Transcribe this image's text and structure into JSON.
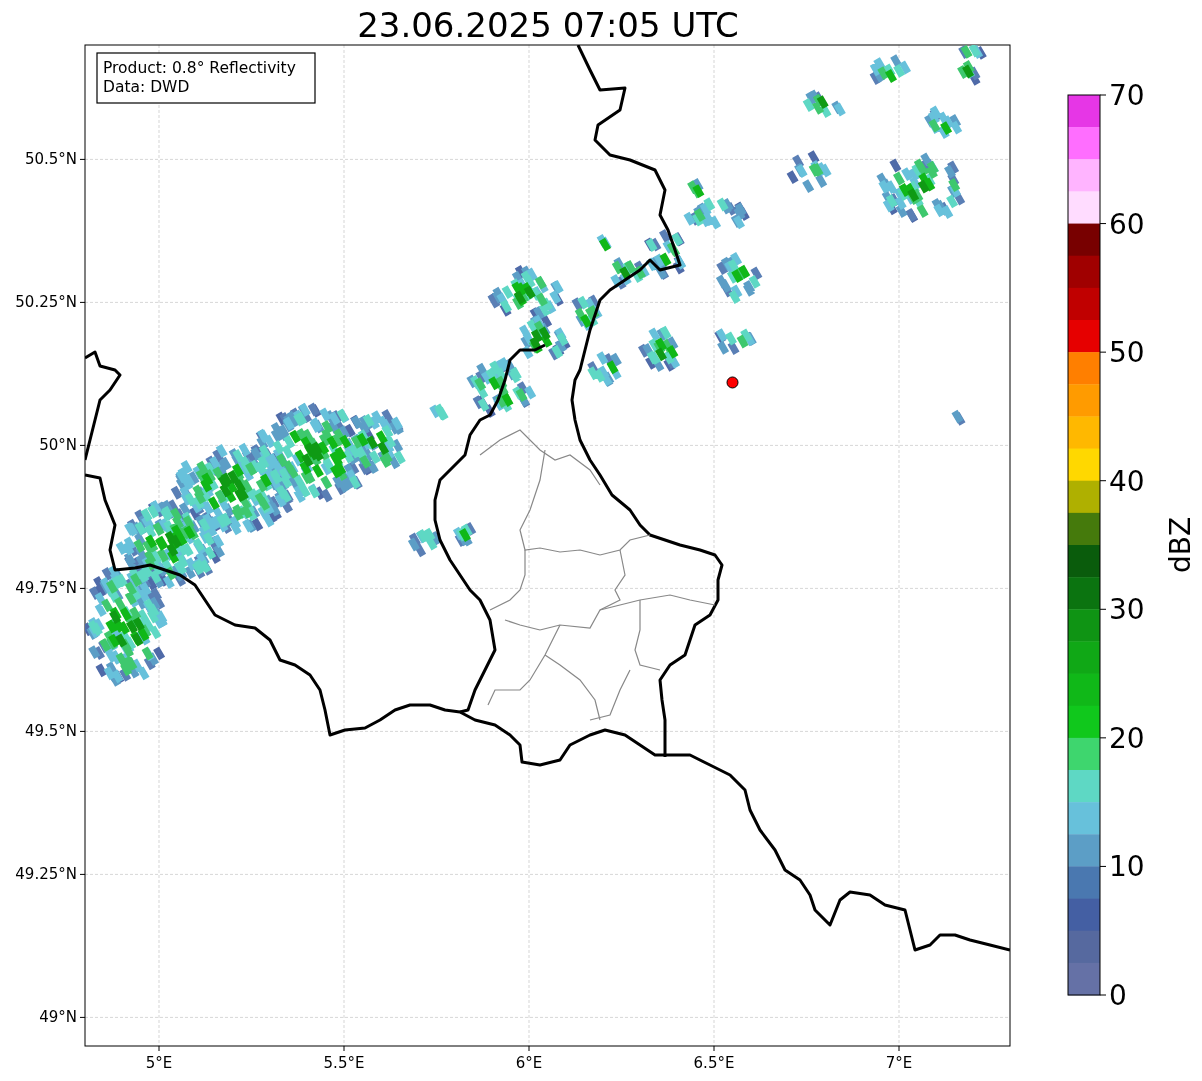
{
  "chart": {
    "chart_data": {
      "type": "scatter",
      "title": "23.06.2025 07:05 UTC",
      "grid": true,
      "x": [
        6.55
      ],
      "series": [
        {
          "color": "#ff0000",
          "values": [
            50.11
          ]
        }
      ],
      "xlim": [
        4.8,
        7.3
      ],
      "ylim": [
        48.95,
        50.7
      ],
      "xticks": [
        {
          "value": 5,
          "label": "5°E"
        },
        {
          "value": 5.5,
          "label": "5.5°E"
        },
        {
          "value": 6,
          "label": "6°E"
        },
        {
          "value": 6.5,
          "label": "6.5°E"
        },
        {
          "value": 7,
          "label": "7°E"
        }
      ],
      "yticks": [
        {
          "value": 49,
          "label": "49°N"
        },
        {
          "value": 49.25,
          "label": "49.25°N"
        },
        {
          "value": 49.5,
          "label": "49.5°N"
        },
        {
          "value": 49.75,
          "label": "49.75°N"
        },
        {
          "value": 50,
          "label": "50°N"
        },
        {
          "value": 50.25,
          "label": "50.25°N"
        },
        {
          "value": 50.5,
          "label": "50.5°N"
        }
      ]
    },
    "info_box": [
      "Product: 0.8° Reflectivity",
      "Data: DWD"
    ]
  },
  "colorbar": {
    "label": "dBZ",
    "ticks": [
      "70",
      "60",
      "50",
      "40",
      "30",
      "20",
      "10",
      "0"
    ],
    "steps": [
      {
        "color": "#e636e6"
      },
      {
        "color": "#ff6eff"
      },
      {
        "color": "#ffb4ff"
      },
      {
        "color": "#ffdcff"
      },
      {
        "color": "#780000"
      },
      {
        "color": "#a00000"
      },
      {
        "color": "#c00000"
      },
      {
        "color": "#e60000"
      },
      {
        "color": "#ff7f00"
      },
      {
        "color": "#ff9b00"
      },
      {
        "color": "#ffb800"
      },
      {
        "color": "#ffd800"
      },
      {
        "color": "#afb000"
      },
      {
        "color": "#457a0c"
      },
      {
        "color": "#0a5c0c"
      },
      {
        "color": "#0b7410"
      },
      {
        "color": "#0f9414"
      },
      {
        "color": "#10a816"
      },
      {
        "color": "#10b818"
      },
      {
        "color": "#10c81c"
      },
      {
        "color": "#3ed66e"
      },
      {
        "color": "#5ed8c4"
      },
      {
        "color": "#67c1db"
      },
      {
        "color": "#5c9ec6"
      },
      {
        "color": "#4a78b0"
      },
      {
        "color": "#445fa3"
      },
      {
        "color": "#56699f"
      },
      {
        "color": "#6571a6"
      }
    ]
  }
}
